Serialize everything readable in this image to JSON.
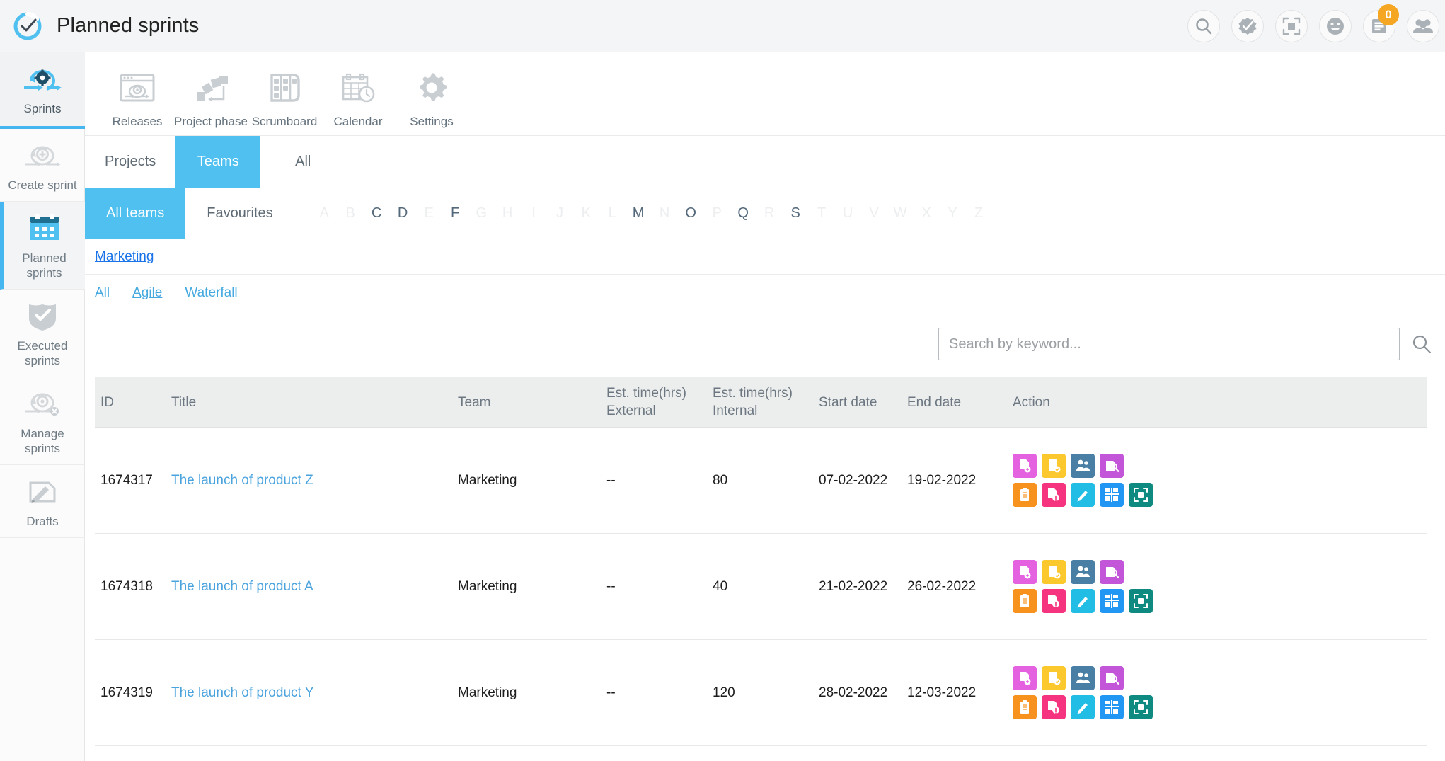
{
  "header": {
    "title": "Planned sprints",
    "logo_icon": "check-circle-logo",
    "actions": [
      {
        "icon": "search-icon",
        "name": "search"
      },
      {
        "icon": "approvals-icon",
        "name": "approvals"
      },
      {
        "icon": "fullscreen-icon",
        "name": "fullscreen"
      },
      {
        "icon": "smiley-icon",
        "name": "feedback"
      },
      {
        "icon": "notes-icon",
        "name": "notes",
        "badge": "0"
      },
      {
        "icon": "people-icon",
        "name": "people"
      }
    ]
  },
  "sidebar": {
    "items": [
      {
        "label": "Sprints",
        "icon": "sprint-cycle-icon",
        "state": "section"
      },
      {
        "label": "Create sprint",
        "icon": "add-sprint-icon",
        "state": "normal"
      },
      {
        "label": "Planned sprints",
        "icon": "calendar-grid-icon",
        "state": "active"
      },
      {
        "label": "Executed sprints",
        "icon": "shield-check-icon",
        "state": "normal"
      },
      {
        "label": "Manage sprints",
        "icon": "manage-sprint-icon",
        "state": "normal"
      },
      {
        "label": "Drafts",
        "icon": "draft-edit-icon",
        "state": "normal"
      }
    ]
  },
  "modules": [
    {
      "label": "Releases",
      "icon": "releases-window-icon"
    },
    {
      "label": "Project phase",
      "icon": "project-phase-icon"
    },
    {
      "label": "Scrumboard",
      "icon": "scrumboard-icon"
    },
    {
      "label": "Calendar",
      "icon": "calendar-clock-icon"
    },
    {
      "label": "Settings",
      "icon": "gear-icon"
    }
  ],
  "scope_tabs": [
    {
      "label": "Projects",
      "active": false
    },
    {
      "label": "Teams",
      "active": true
    },
    {
      "label": "All",
      "active": false
    }
  ],
  "alpha_bar": {
    "all_label": "All teams",
    "all_active": true,
    "favourites_label": "Favourites",
    "letters": [
      {
        "ch": "A",
        "enabled": false
      },
      {
        "ch": "B",
        "enabled": false
      },
      {
        "ch": "C",
        "enabled": true
      },
      {
        "ch": "D",
        "enabled": true
      },
      {
        "ch": "E",
        "enabled": false
      },
      {
        "ch": "F",
        "enabled": true
      },
      {
        "ch": "G",
        "enabled": false
      },
      {
        "ch": "H",
        "enabled": false
      },
      {
        "ch": "I",
        "enabled": false
      },
      {
        "ch": "J",
        "enabled": false
      },
      {
        "ch": "K",
        "enabled": false
      },
      {
        "ch": "L",
        "enabled": false
      },
      {
        "ch": "M",
        "enabled": true
      },
      {
        "ch": "N",
        "enabled": false
      },
      {
        "ch": "O",
        "enabled": true
      },
      {
        "ch": "P",
        "enabled": false
      },
      {
        "ch": "Q",
        "enabled": true
      },
      {
        "ch": "R",
        "enabled": false
      },
      {
        "ch": "S",
        "enabled": true
      },
      {
        "ch": "T",
        "enabled": false
      },
      {
        "ch": "U",
        "enabled": false
      },
      {
        "ch": "V",
        "enabled": false
      },
      {
        "ch": "W",
        "enabled": false
      },
      {
        "ch": "X",
        "enabled": false
      },
      {
        "ch": "Y",
        "enabled": false
      },
      {
        "ch": "Z",
        "enabled": false
      }
    ]
  },
  "breadcrumb": {
    "team": "Marketing"
  },
  "type_filters": [
    {
      "label": "All",
      "underlined": false
    },
    {
      "label": "Agile",
      "underlined": true
    },
    {
      "label": "Waterfall",
      "underlined": false
    }
  ],
  "search": {
    "placeholder": "Search by keyword...",
    "value": "",
    "icon": "search-icon"
  },
  "table": {
    "columns": {
      "id": "ID",
      "title": "Title",
      "team": "Team",
      "ext_line1": "Est. time(hrs)",
      "ext_line2": "External",
      "int_line1": "Est. time(hrs)",
      "int_line2": "Internal",
      "start": "Start date",
      "end": "End date",
      "action": "Action"
    },
    "rows": [
      {
        "id": "1674317",
        "title": "The launch of product Z",
        "team": "Marketing",
        "ext": "--",
        "int": "80",
        "start": "07-02-2022",
        "end": "19-02-2022"
      },
      {
        "id": "1674318",
        "title": "The launch of product A",
        "team": "Marketing",
        "ext": "--",
        "int": "40",
        "start": "21-02-2022",
        "end": "26-02-2022"
      },
      {
        "id": "1674319",
        "title": "The launch of product Y",
        "team": "Marketing",
        "ext": "--",
        "int": "120",
        "start": "28-02-2022",
        "end": "12-03-2022"
      }
    ],
    "action_icons": [
      {
        "name": "copy-sprint-icon",
        "color": "#e461e0"
      },
      {
        "name": "approve-task-icon",
        "color": "#fbc82e"
      },
      {
        "name": "assign-team-icon",
        "color": "#4a7fa5"
      },
      {
        "name": "review-docs-icon",
        "color": "#c355d8"
      },
      {
        "name": "backlog-icon",
        "color": "#f7921e"
      },
      {
        "name": "sprint-info-icon",
        "color": "#f5337f"
      },
      {
        "name": "edit-icon",
        "color": "#22bde5"
      },
      {
        "name": "scrumboard-view-icon",
        "color": "#2196f3"
      },
      {
        "name": "expand-view-icon",
        "color": "#0e8a80"
      }
    ]
  },
  "colors": {
    "accent": "#4fc0f0",
    "link": "#4aa3dd",
    "badge": "#f5a623"
  }
}
